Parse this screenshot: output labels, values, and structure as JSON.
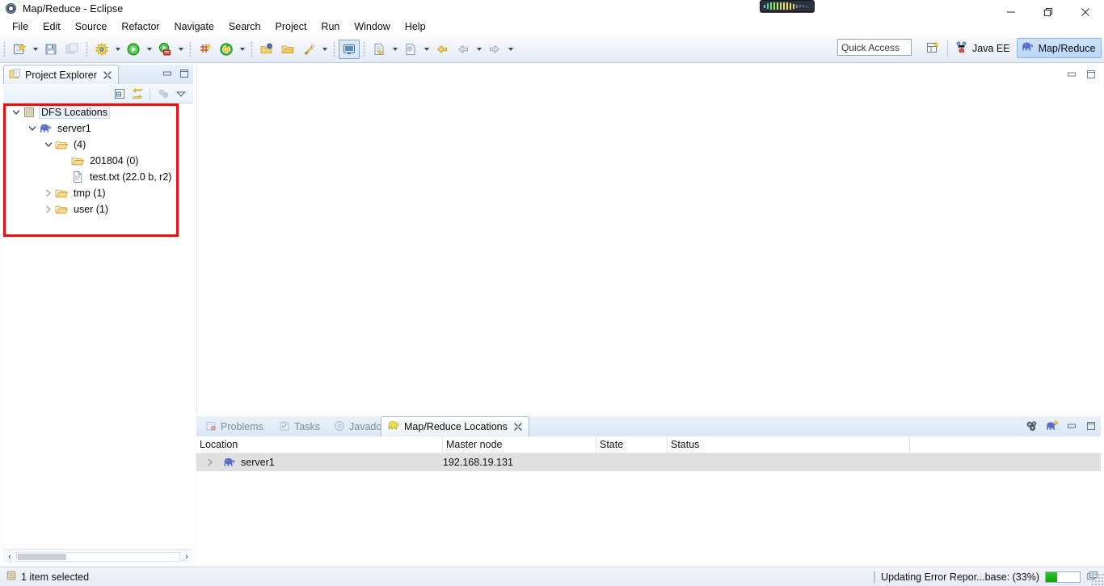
{
  "window": {
    "title": "Map/Reduce - Eclipse",
    "icon": "eclipse-icon",
    "minimize_label": "Minimize",
    "maximize_label": "Restore",
    "close_label": "Close"
  },
  "menubar": {
    "items": [
      {
        "label": "File",
        "name": "menu-file"
      },
      {
        "label": "Edit",
        "name": "menu-edit"
      },
      {
        "label": "Source",
        "name": "menu-source"
      },
      {
        "label": "Refactor",
        "name": "menu-refactor"
      },
      {
        "label": "Navigate",
        "name": "menu-navigate"
      },
      {
        "label": "Search",
        "name": "menu-search"
      },
      {
        "label": "Project",
        "name": "menu-project"
      },
      {
        "label": "Run",
        "name": "menu-run"
      },
      {
        "label": "Window",
        "name": "menu-window"
      },
      {
        "label": "Help",
        "name": "menu-help"
      }
    ]
  },
  "toolbar": {
    "buttons": [
      {
        "name": "new-wizard-icon",
        "tooltip": "New"
      },
      {
        "name": "save-icon",
        "tooltip": "Save"
      },
      {
        "name": "save-all-icon",
        "tooltip": "Save All"
      },
      {
        "name": "debug-icon",
        "tooltip": "Debug"
      },
      {
        "name": "run-icon",
        "tooltip": "Run"
      },
      {
        "name": "run-server-icon",
        "tooltip": "Run on Server"
      },
      {
        "name": "new-java-class-icon",
        "tooltip": "New Java Class"
      },
      {
        "name": "external-tools-icon",
        "tooltip": "External Tools"
      },
      {
        "name": "open-type-icon",
        "tooltip": "Open Type"
      },
      {
        "name": "open-task-icon",
        "tooltip": "Open Task"
      },
      {
        "name": "quick-fix-icon",
        "tooltip": "Quick Fix"
      },
      {
        "name": "terminal-icon",
        "tooltip": "Terminal"
      },
      {
        "name": "next-annotation-icon",
        "tooltip": "Next Annotation"
      },
      {
        "name": "previous-annotation-icon",
        "tooltip": "Previous Annotation"
      },
      {
        "name": "back-icon",
        "tooltip": "Back"
      },
      {
        "name": "forward-icon",
        "tooltip": "Forward"
      }
    ]
  },
  "quick_access": {
    "placeholder": "Quick Access",
    "value": "Quick Access"
  },
  "perspectives": {
    "open_button_name": "open-perspective-icon",
    "items": [
      {
        "label": "Java EE",
        "name": "perspective-java-ee",
        "active": false,
        "icon": "java-ee-icon"
      },
      {
        "label": "Map/Reduce",
        "name": "perspective-map-reduce",
        "active": true,
        "icon": "elephant-icon"
      }
    ]
  },
  "project_explorer": {
    "tab_label": "Project Explorer",
    "tab_icon": "project-explorer-icon",
    "close_icon": "close-icon",
    "view_buttons": [
      {
        "name": "view-minimize-button",
        "icon": "minimize-icon"
      },
      {
        "name": "view-maximize-button",
        "icon": "maximize-icon"
      }
    ],
    "tool_buttons": [
      {
        "name": "collapse-all-button",
        "icon": "collapse-all-icon"
      },
      {
        "name": "link-with-editor-button",
        "icon": "link-editor-icon"
      },
      {
        "name": "focus-on-active-task-button",
        "icon": "focus-task-icon"
      },
      {
        "name": "view-menu-button",
        "icon": "chevron-down-icon"
      }
    ],
    "tree": [
      {
        "label": "DFS Locations",
        "icon": "dfs-locations-icon",
        "depth": 0,
        "twisty": "expanded",
        "selected": true,
        "name": "tree-item-dfs-locations"
      },
      {
        "label": "server1",
        "icon": "elephant-icon",
        "depth": 1,
        "twisty": "expanded",
        "selected": false,
        "name": "tree-item-server1"
      },
      {
        "label": "(4)",
        "icon": "folder-icon",
        "depth": 2,
        "twisty": "expanded",
        "selected": false,
        "name": "tree-item-root-folder"
      },
      {
        "label": "201804 (0)",
        "icon": "folder-icon",
        "depth": 3,
        "twisty": "none",
        "selected": false,
        "name": "tree-item-201804"
      },
      {
        "label": "test.txt (22.0 b, r2)",
        "icon": "file-icon",
        "depth": 3,
        "twisty": "none",
        "selected": false,
        "name": "tree-item-test-txt"
      },
      {
        "label": "tmp (1)",
        "icon": "folder-icon",
        "depth": 2,
        "twisty": "collapsed",
        "selected": false,
        "name": "tree-item-tmp"
      },
      {
        "label": "user (1)",
        "icon": "folder-icon",
        "depth": 2,
        "twisty": "collapsed",
        "selected": false,
        "name": "tree-item-user"
      }
    ],
    "highlight_color": "#e8110f",
    "scroll_left_icon": "chevron-left-icon",
    "scroll_right_icon": "chevron-right-icon"
  },
  "editor_area": {
    "view_buttons": [
      {
        "name": "editor-minimize-button",
        "icon": "minimize-icon"
      },
      {
        "name": "editor-maximize-button",
        "icon": "maximize-icon"
      }
    ]
  },
  "bottom_view": {
    "tabs": [
      {
        "label": "Problems",
        "icon": "problems-icon",
        "active": false,
        "name": "tab-problems"
      },
      {
        "label": "Tasks",
        "icon": "tasks-icon",
        "active": false,
        "name": "tab-tasks"
      },
      {
        "label": "Javadoc",
        "icon": "javadoc-icon",
        "active": false,
        "name": "tab-javadoc"
      },
      {
        "label": "Map/Reduce Locations",
        "icon": "elephant-icon",
        "active": true,
        "name": "tab-map-reduce-locations"
      }
    ],
    "close_icon": "close-icon",
    "view_buttons": [
      {
        "name": "edit-locations-button",
        "icon": "gears-icon"
      },
      {
        "name": "new-hadoop-location-button",
        "icon": "elephant-new-icon"
      },
      {
        "name": "bottom-minimize-button",
        "icon": "minimize-icon"
      },
      {
        "name": "bottom-maximize-button",
        "icon": "maximize-icon"
      }
    ],
    "table": {
      "columns": [
        {
          "label": "Location",
          "name": "column-location"
        },
        {
          "label": "Master node",
          "name": "column-master-node"
        },
        {
          "label": "State",
          "name": "column-state"
        },
        {
          "label": "Status",
          "name": "column-status"
        }
      ],
      "rows": [
        {
          "location": "server1",
          "master_node": "192.168.19.131",
          "state": "",
          "status": "",
          "icon": "elephant-icon",
          "twisty": "collapsed",
          "name": "table-row-server1"
        }
      ]
    }
  },
  "statusbar": {
    "left_icon": "dfs-locations-icon",
    "left_text": "1 item selected",
    "progress_text": "Updating Error Repor...base: (33%)",
    "progress_percent": 33,
    "progress_color": "#22b31b",
    "progress_detail_icon": "progress-details-icon"
  }
}
